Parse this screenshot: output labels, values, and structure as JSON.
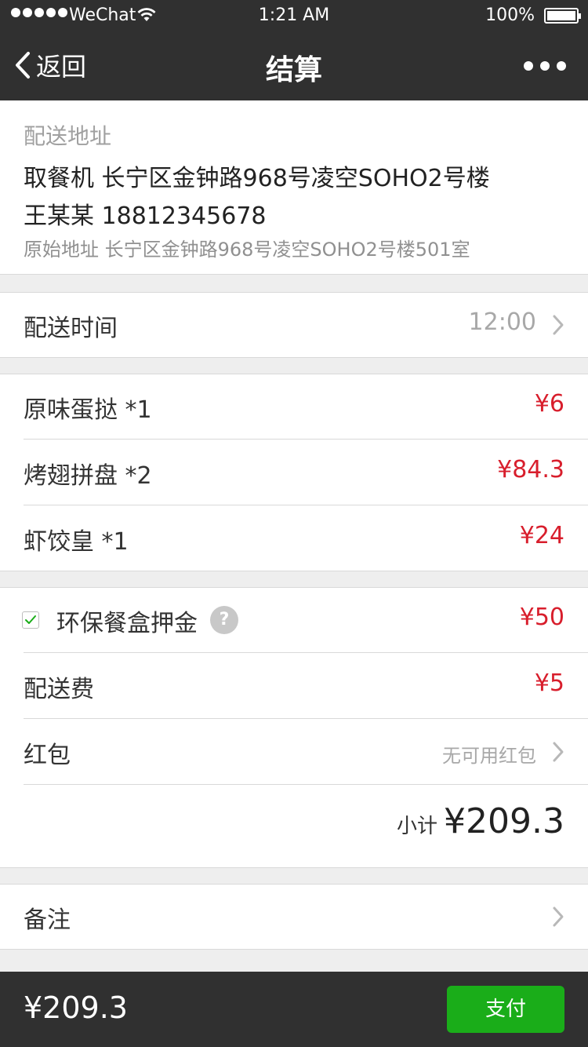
{
  "status_bar": {
    "carrier": "WeChat",
    "time": "1:21 AM",
    "battery": "100%"
  },
  "nav": {
    "back_label": "返回",
    "title": "结算"
  },
  "address": {
    "section_label": "配送地址",
    "main": "取餐机 长宁区金钟路968号凌空SOHO2号楼",
    "contact": "王某某 18812345678",
    "original": "原始地址 长宁区金钟路968号凌空SOHO2号楼501室"
  },
  "delivery_time": {
    "label": "配送时间",
    "value": "12:00"
  },
  "items": [
    {
      "name": "原味蛋挞 *1",
      "price": "¥6"
    },
    {
      "name": "烤翅拼盘 *2",
      "price": "¥84.3"
    },
    {
      "name": "虾饺皇 *1",
      "price": "¥24"
    }
  ],
  "fees": {
    "box_deposit_label": "环保餐盒押金",
    "box_deposit_price": "¥50",
    "box_deposit_checked": true,
    "delivery_fee_label": "配送费",
    "delivery_fee_price": "¥5",
    "red_packet_label": "红包",
    "red_packet_value": "无可用红包",
    "subtotal_label": "小计",
    "subtotal_value": "¥209.3"
  },
  "note": {
    "label": "备注"
  },
  "footer": {
    "total": "¥209.3",
    "pay_label": "支付"
  },
  "colors": {
    "bar_bg": "#303030",
    "price_red": "#d81e2c",
    "pay_green": "#1aad19",
    "check_green": "#1aad19"
  }
}
